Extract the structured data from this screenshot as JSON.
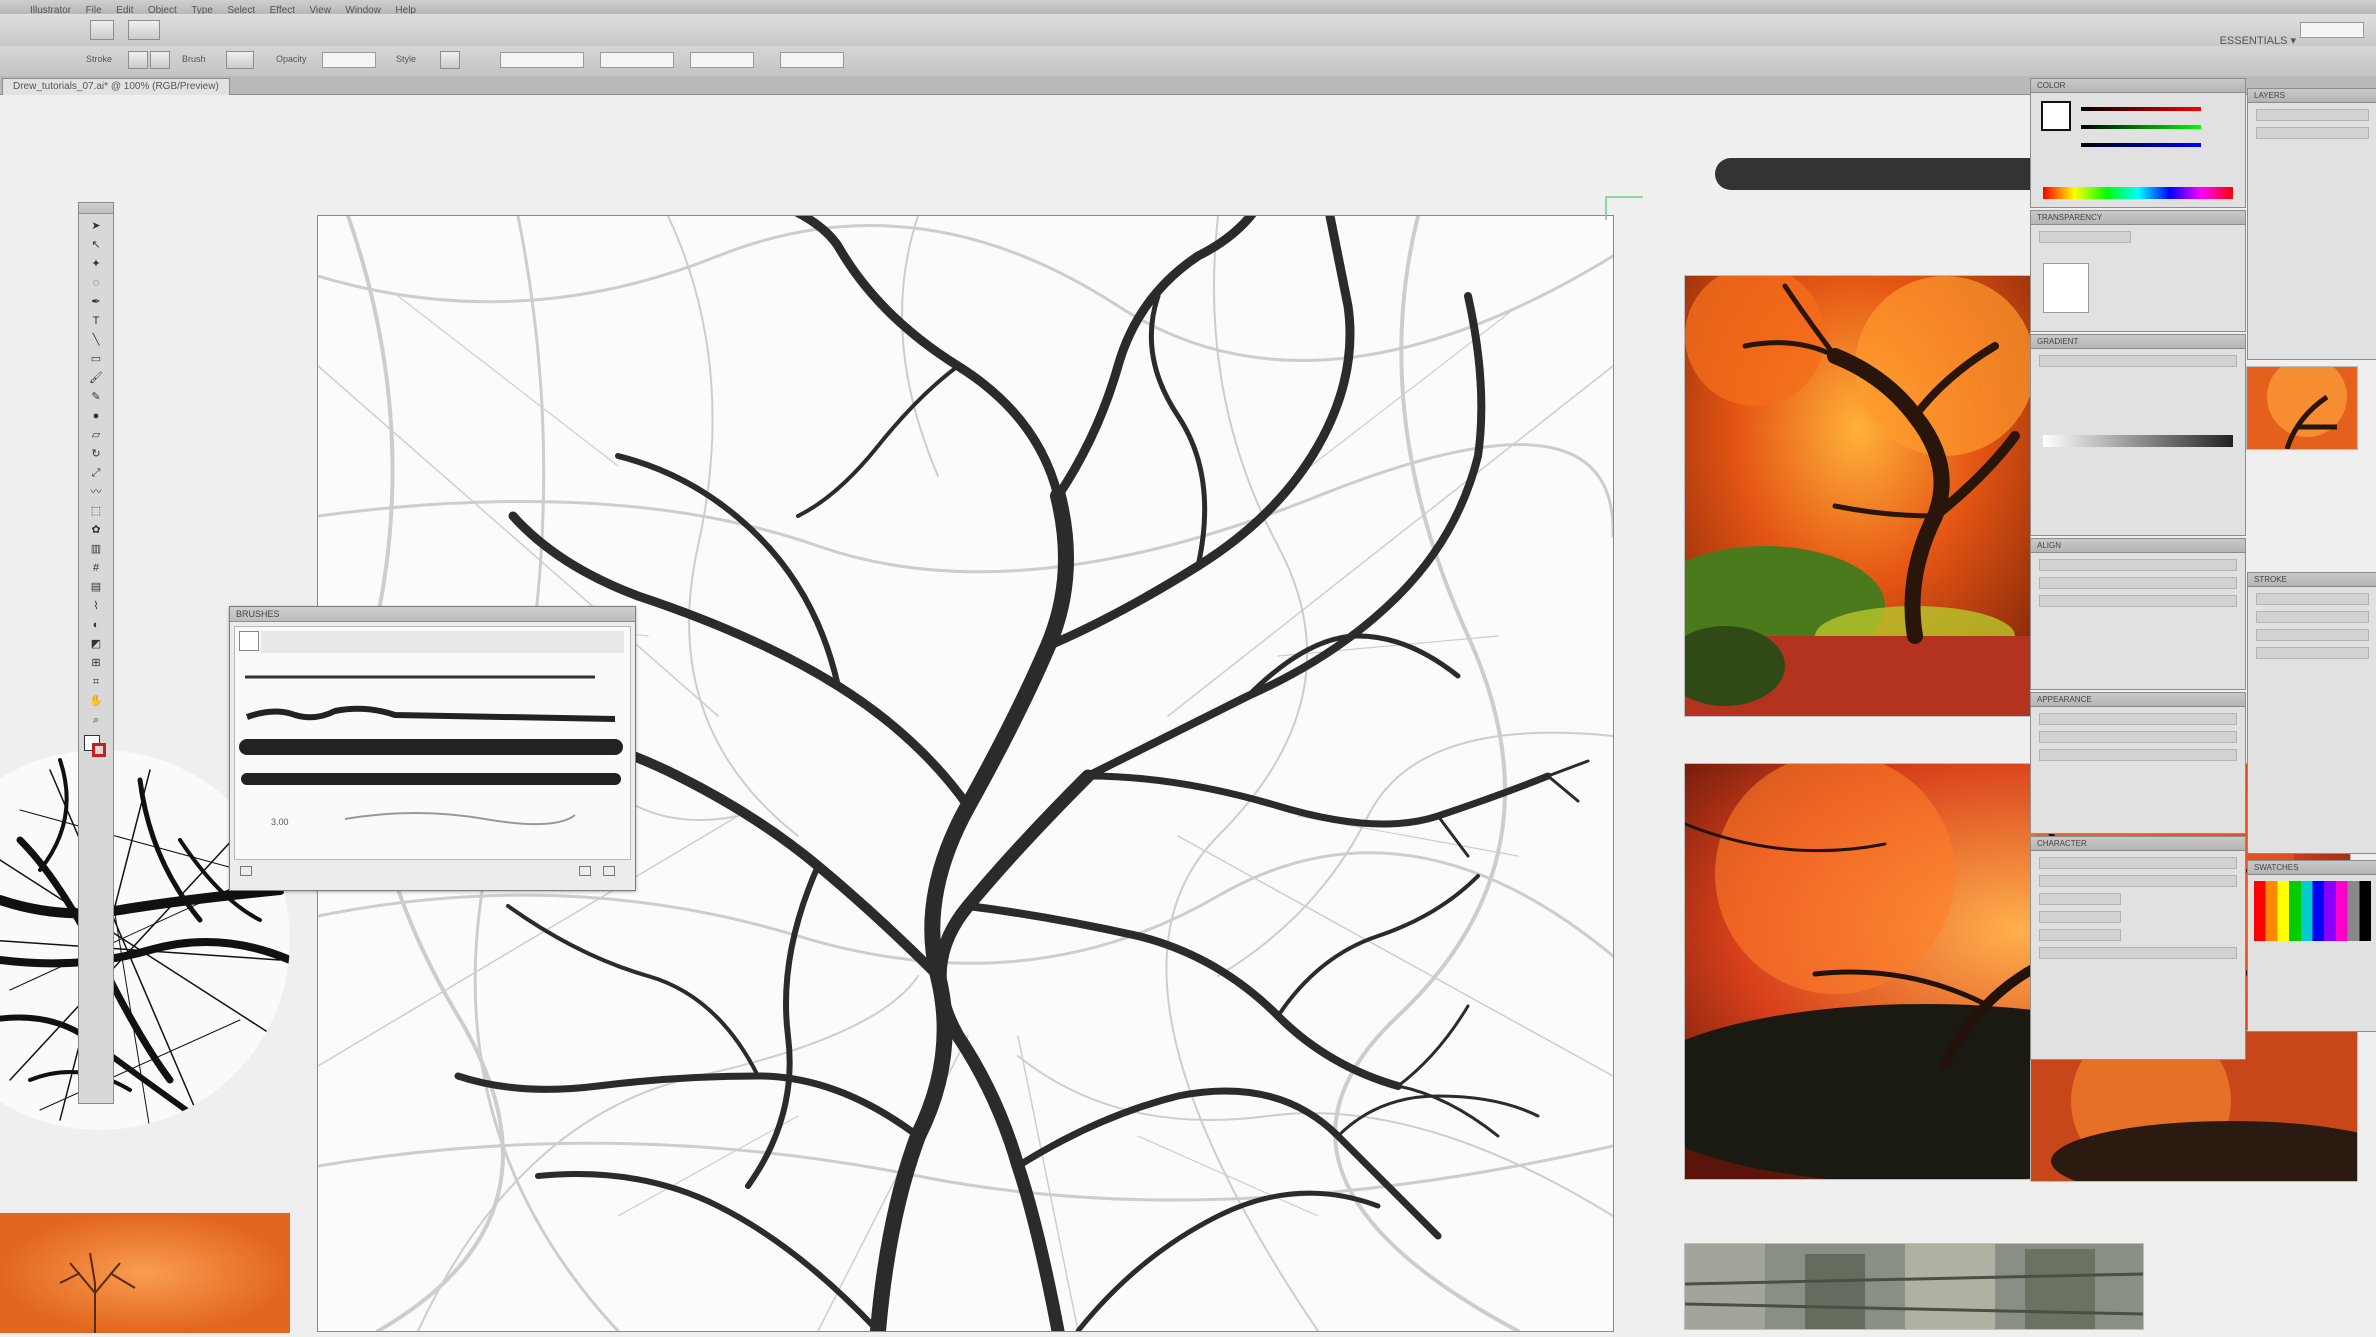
{
  "menubar": {
    "items": [
      "Illustrator",
      "File",
      "Edit",
      "Object",
      "Type",
      "Select",
      "Effect",
      "View",
      "Window",
      "Help"
    ]
  },
  "appbar": {
    "workspace_label": "ESSENTIALS ▾"
  },
  "controlbar": {
    "labels": [
      "Stroke",
      "Brush",
      "Opacity",
      "Style"
    ],
    "fields": [
      "",
      "",
      "",
      ""
    ]
  },
  "document": {
    "tab_label": "Drew_tutorials_07.ai* @ 100% (RGB/Preview)"
  },
  "brushes_panel": {
    "title": "BRUSHES",
    "size_label": "3.00"
  },
  "right_panels": {
    "color": "COLOR",
    "layers": "LAYERS",
    "transparency": "TRANSPARENCY",
    "gradient": "GRADIENT",
    "align": "ALIGN",
    "appearance": "APPEARANCE",
    "character": "CHARACTER",
    "stroke": "STROKE",
    "swatches": "SWATCHES"
  },
  "colors": {
    "ui_bg": "#e9e9e9",
    "artboard": "#fbfbfb",
    "branch": "#2b2b2b",
    "autumn_orange": "#e05a1e"
  },
  "icons": [
    "selection-tool-icon",
    "brush-icon",
    "pen-icon",
    "type-icon",
    "zoom-icon"
  ]
}
